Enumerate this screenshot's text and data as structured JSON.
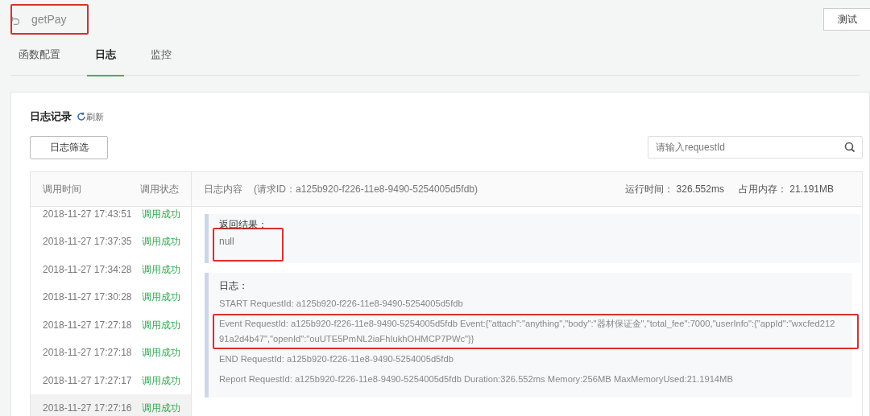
{
  "header": {
    "title": "getPay",
    "title_highlighted": true,
    "test_button": "测试"
  },
  "tabs": [
    {
      "label": "函数配置",
      "selected": false
    },
    {
      "label": "日志",
      "selected": true
    },
    {
      "label": "监控",
      "selected": false
    }
  ],
  "log_panel": {
    "title": "日志记录",
    "refresh": "刷新",
    "filter_button": "日志筛选",
    "search": {
      "placeholder": "请输入requestId"
    },
    "columns": [
      "调用时间",
      "调用状态"
    ],
    "detail_header": {
      "label": "日志内容",
      "request_id": "(请求ID：a125b920-f226-11e8-9490-5254005d5fdb)",
      "run_time": "运行时间： 326.552ms",
      "memory": "占用内存： 21.191MB"
    },
    "invocations": [
      {
        "time": "2018-11-27 17:43:51",
        "status": "调用成功",
        "selected": false
      },
      {
        "time": "2018-11-27 17:37:35",
        "status": "调用成功",
        "selected": false
      },
      {
        "time": "2018-11-27 17:34:28",
        "status": "调用成功",
        "selected": false
      },
      {
        "time": "2018-11-27 17:30:28",
        "status": "调用成功",
        "selected": false
      },
      {
        "time": "2018-11-27 17:27:18",
        "status": "调用成功",
        "selected": false
      },
      {
        "time": "2018-11-27 17:27:18",
        "status": "调用成功",
        "selected": false
      },
      {
        "time": "2018-11-27 17:27:17",
        "status": "调用成功",
        "selected": false
      },
      {
        "time": "2018-11-27 17:27:16",
        "status": "调用成功",
        "selected": true
      }
    ],
    "result": {
      "label": "返回结果：",
      "value": "null",
      "highlighted": true
    },
    "log": {
      "label": "日志：",
      "entries": [
        {
          "lines": [
            "START RequestId: a125b920-f226-11e8-9490-5254005d5fdb"
          ],
          "highlighted": false
        },
        {
          "lines": [
            "Event RequestId: a125b920-f226-11e8-9490-5254005d5fdb Event:{\"attach\":\"anything\",\"body\":\"器材保证金\",\"total_fee\":7000,\"userInfo\":{\"appId\":\"wxcfed212",
            "91a2d4b47\",\"openId\":\"ouUTE5PmNL2iaFhIukhOHMCP7PWc\"}}"
          ],
          "highlighted": true
        },
        {
          "lines": [
            "END RequestId: a125b920-f226-11e8-9490-5254005d5fdb"
          ],
          "highlighted": false
        },
        {
          "lines": [
            "Report RequestId: a125b920-f226-11e8-9490-5254005d5fdb Duration:326.552ms Memory:256MB MaxMemoryUsed:21.1914MB"
          ],
          "highlighted": false
        }
      ]
    }
  }
}
